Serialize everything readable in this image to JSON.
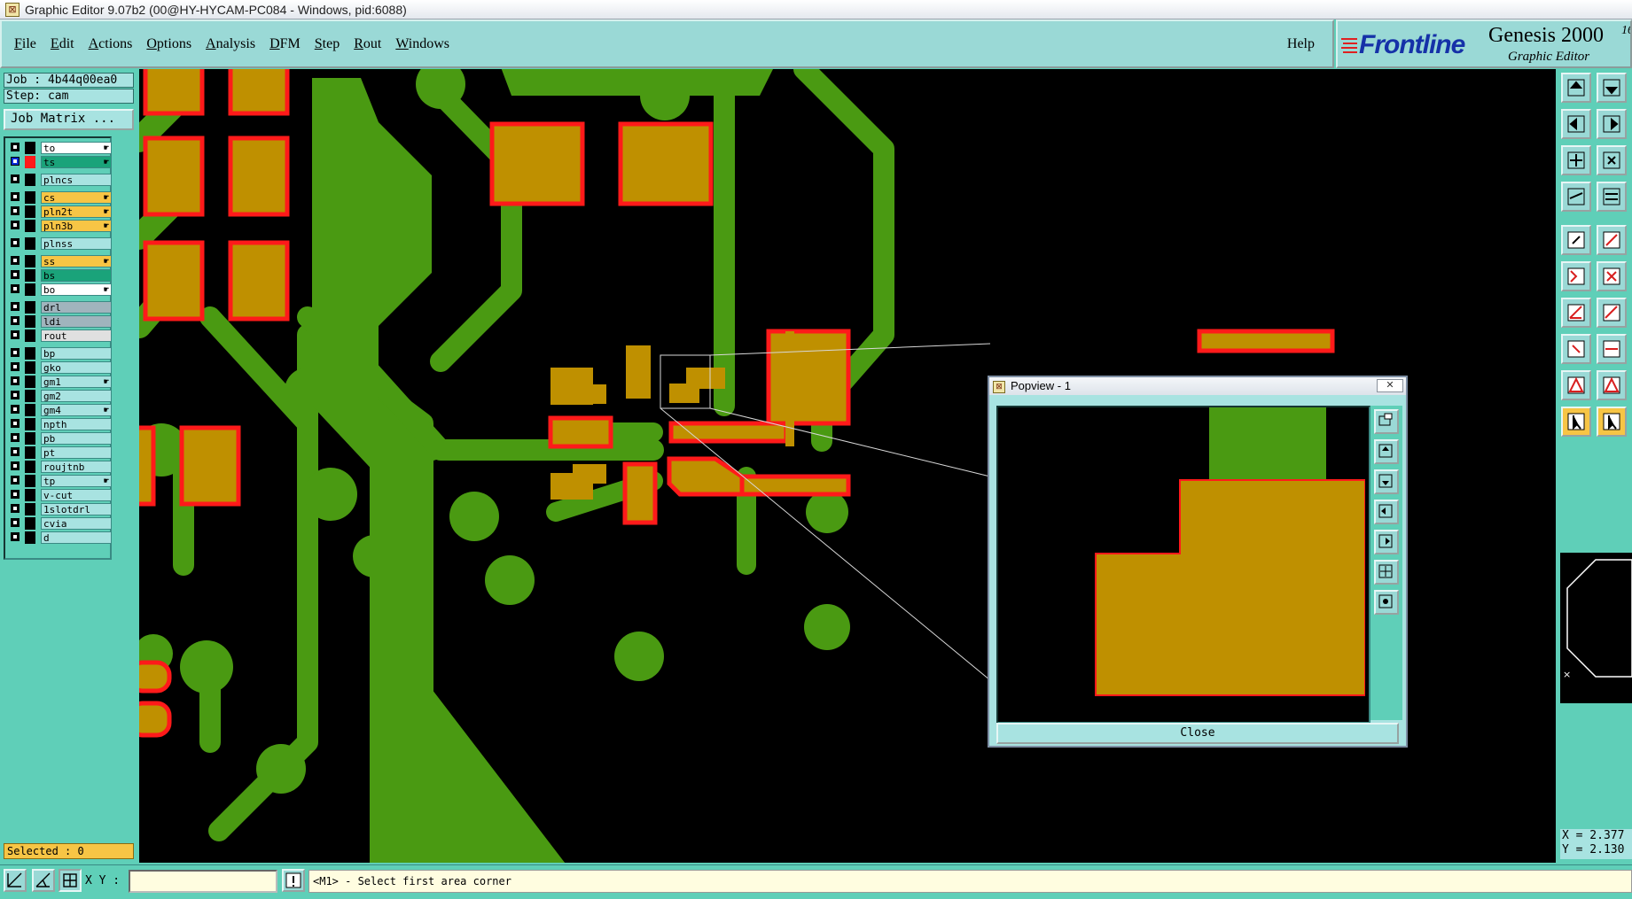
{
  "window": {
    "title": "Graphic Editor 9.07b2 (00@HY-HYCAM-PC084 - Windows, pid:6088)"
  },
  "menu": {
    "items": [
      "File",
      "Edit",
      "Actions",
      "Options",
      "Analysis",
      "DFM",
      "Step",
      "Rout",
      "Windows"
    ],
    "help": "Help"
  },
  "brand": {
    "logo": "Frontline",
    "product": "Genesis 2000",
    "superscript": "16",
    "subtitle": "Graphic Editor"
  },
  "job": {
    "job_label": "Job : 4b44q00ea0",
    "step_label": "Step: cam",
    "matrix_button": "Job Matrix ..."
  },
  "layers": [
    {
      "name": "to",
      "color": "#ffffff",
      "swatch": "#000000",
      "checked": false,
      "hand": true
    },
    {
      "name": "ts",
      "color": "#1aa37a",
      "swatch": "#ff1a1a",
      "checked": true,
      "hand": true
    },
    {
      "name": "plncs",
      "color": "#a8e3e1",
      "swatch": "#000000",
      "checked": false,
      "hand": false
    },
    {
      "name": "cs",
      "color": "#f7c545",
      "swatch": "#000000",
      "checked": false,
      "hand": true
    },
    {
      "name": "pln2t",
      "color": "#f7c545",
      "swatch": "#000000",
      "checked": false,
      "hand": true
    },
    {
      "name": "pln3b",
      "color": "#f7c545",
      "swatch": "#000000",
      "checked": false,
      "hand": true
    },
    {
      "name": "plnss",
      "color": "#a8e3e1",
      "swatch": "#000000",
      "checked": false,
      "hand": false
    },
    {
      "name": "ss",
      "color": "#f7c545",
      "swatch": "#000000",
      "checked": false,
      "hand": true
    },
    {
      "name": "bs",
      "color": "#1aa37a",
      "swatch": "#000000",
      "checked": false,
      "hand": false
    },
    {
      "name": "bo",
      "color": "#ffffff",
      "swatch": "#000000",
      "checked": false,
      "hand": true
    },
    {
      "name": "drl",
      "color": "#a0b4bd",
      "swatch": "#000000",
      "checked": false,
      "hand": false
    },
    {
      "name": "ldi",
      "color": "#a0b4bd",
      "swatch": "#000000",
      "checked": false,
      "hand": false
    },
    {
      "name": "rout",
      "color": "#e0e0e0",
      "swatch": "#000000",
      "checked": false,
      "hand": false
    },
    {
      "name": "bp",
      "color": "#a8e3e1",
      "swatch": "#000000",
      "checked": false,
      "hand": false
    },
    {
      "name": "gko",
      "color": "#a8e3e1",
      "swatch": "#000000",
      "checked": false,
      "hand": false
    },
    {
      "name": "gm1",
      "color": "#a8e3e1",
      "swatch": "#000000",
      "checked": false,
      "hand": true
    },
    {
      "name": "gm2",
      "color": "#a8e3e1",
      "swatch": "#000000",
      "checked": false,
      "hand": false
    },
    {
      "name": "gm4",
      "color": "#a8e3e1",
      "swatch": "#000000",
      "checked": false,
      "hand": true
    },
    {
      "name": "npth",
      "color": "#a8e3e1",
      "swatch": "#000000",
      "checked": false,
      "hand": false
    },
    {
      "name": "pb",
      "color": "#a8e3e1",
      "swatch": "#000000",
      "checked": false,
      "hand": false
    },
    {
      "name": "pt",
      "color": "#a8e3e1",
      "swatch": "#000000",
      "checked": false,
      "hand": false
    },
    {
      "name": "roujtnb",
      "color": "#a8e3e1",
      "swatch": "#000000",
      "checked": false,
      "hand": false
    },
    {
      "name": "tp",
      "color": "#a8e3e1",
      "swatch": "#000000",
      "checked": false,
      "hand": true
    },
    {
      "name": "v-cut",
      "color": "#a8e3e1",
      "swatch": "#000000",
      "checked": false,
      "hand": false
    },
    {
      "name": "1slotdrl",
      "color": "#a8e3e1",
      "swatch": "#000000",
      "checked": false,
      "hand": false
    },
    {
      "name": "cvia",
      "color": "#a8e3e1",
      "swatch": "#000000",
      "checked": false,
      "hand": false
    },
    {
      "name": "d",
      "color": "#a8e3e1",
      "swatch": "#000000",
      "checked": false,
      "hand": false
    }
  ],
  "selected": "Selected : 0",
  "popview": {
    "title": "Popview - 1",
    "close_label": "Close"
  },
  "coords": {
    "x": "X = 2.377",
    "y": "Y = 2.130"
  },
  "status": {
    "xy_label": "X Y :",
    "xy_value": "",
    "message": "<M1> - Select first area corner"
  },
  "colors": {
    "copper": "#bf9000",
    "trace": "#4a9a12",
    "highlight": "#ff1a1a",
    "panel": "#5fcfb8",
    "button": "#9ad9d6"
  }
}
